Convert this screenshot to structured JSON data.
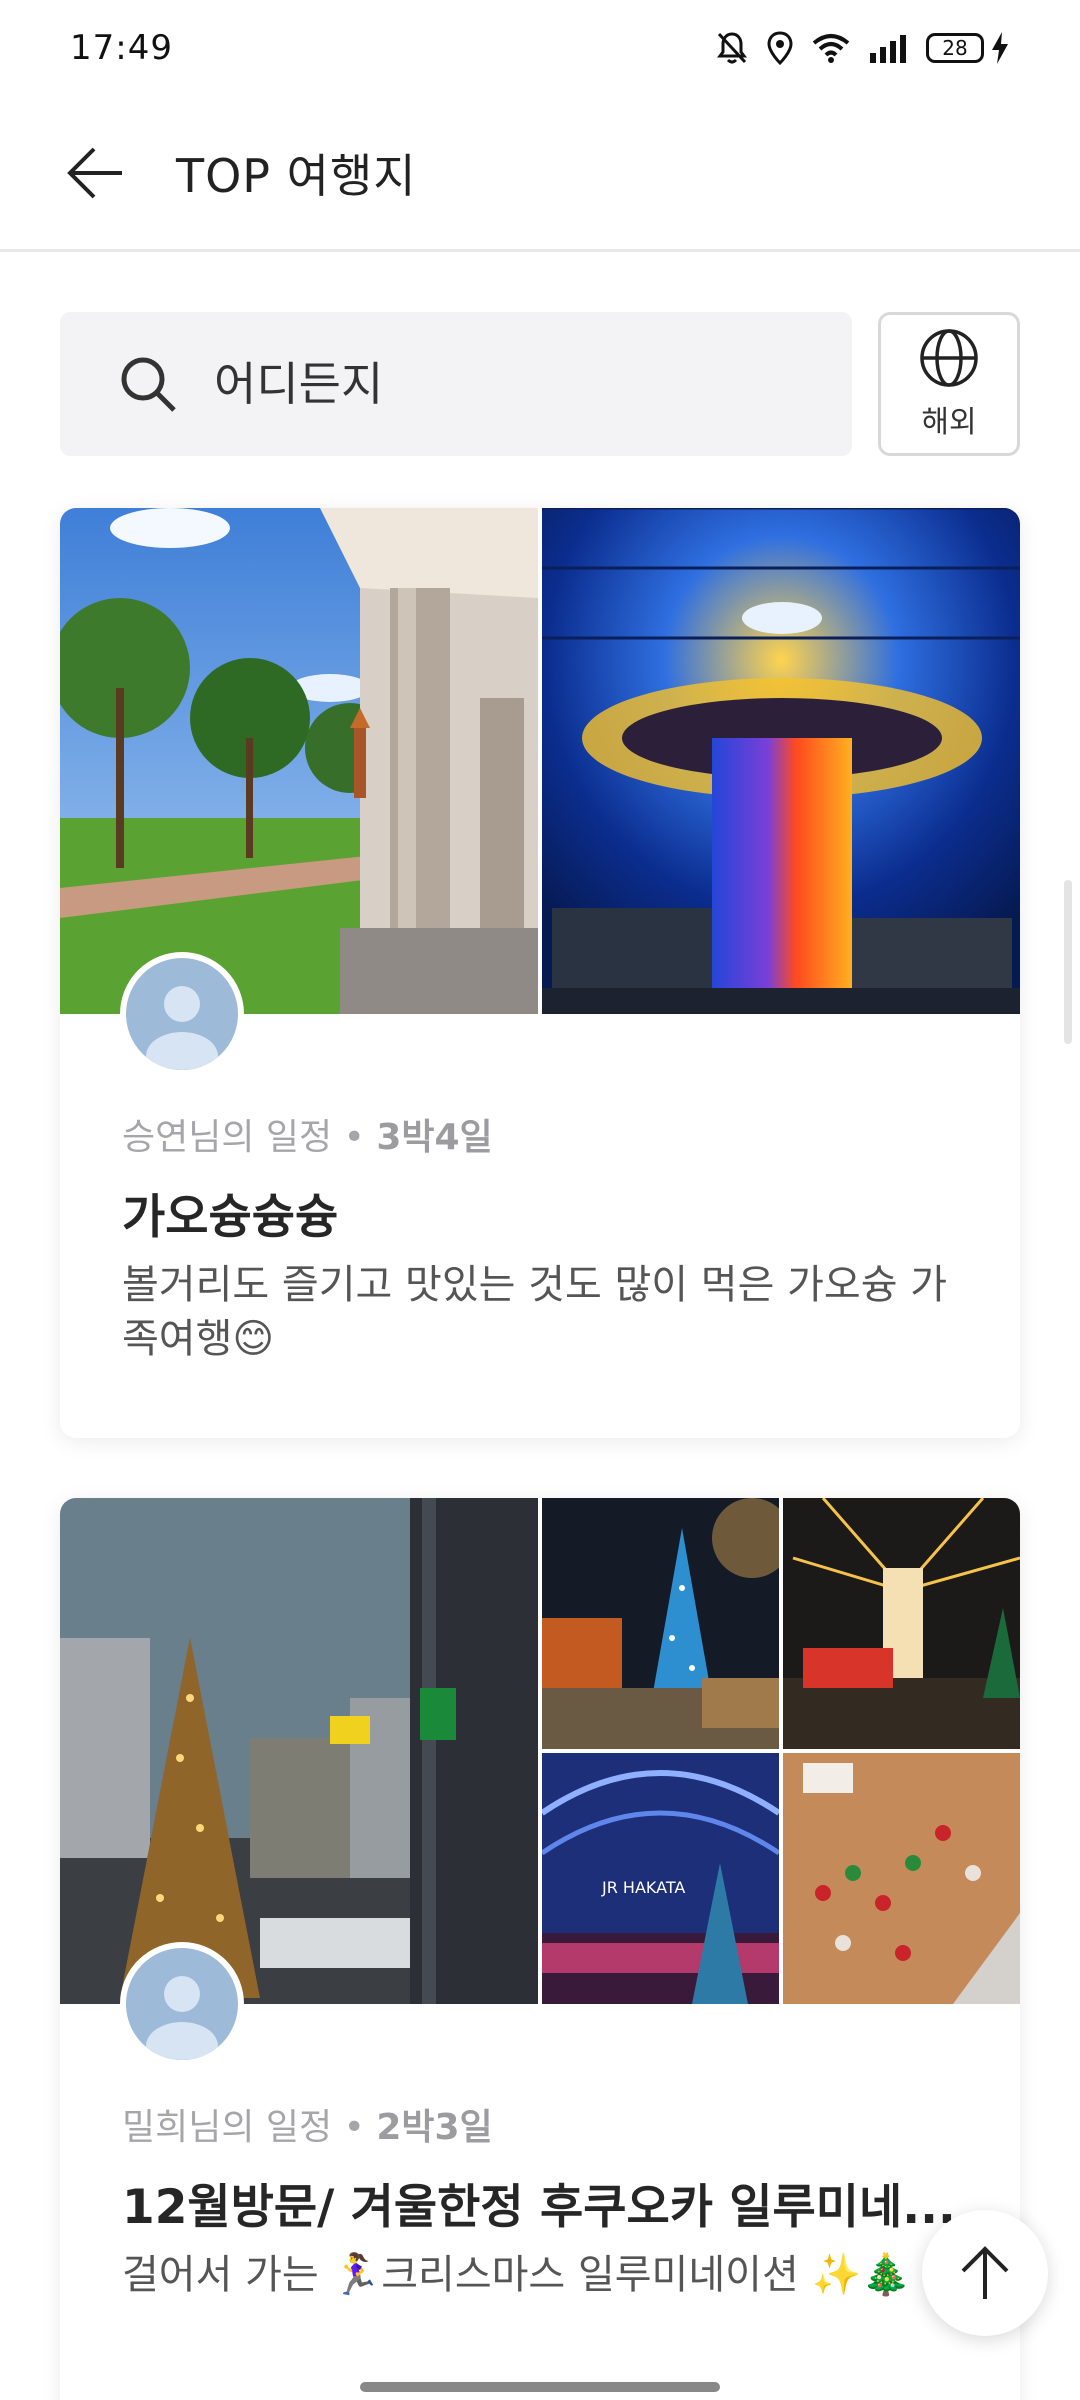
{
  "status_bar": {
    "time": "17:49",
    "battery": "28"
  },
  "header": {
    "title": "TOP 여행지"
  },
  "search": {
    "placeholder": "어디든지",
    "overseas_label": "해외"
  },
  "cards": [
    {
      "owner": "승연님의 일정",
      "separator": "•",
      "duration": "3박4일",
      "title": "가오슝슝슝",
      "description": "볼거리도 즐기고 맛있는 것도 많이 먹은 가오슝 가족여행😊"
    },
    {
      "owner": "밀희님의 일정",
      "separator": "•",
      "duration": "2박3일",
      "title": "12월방문/ 겨울한정 후쿠오카 일루미네...",
      "description": "걸어서 가는 🏃‍♀️크리스마스 일루미네이션 ✨🎄"
    }
  ],
  "photo_captions": {
    "card2_station_sign": "JR HAKATA"
  },
  "icons": {
    "back": "arrow-left-icon",
    "search": "search-icon",
    "globe": "globe-icon",
    "scroll_top": "arrow-up-icon"
  }
}
